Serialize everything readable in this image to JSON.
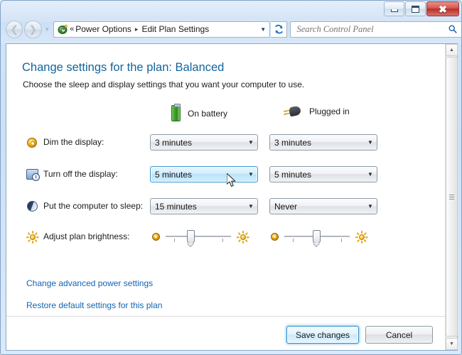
{
  "window": {
    "controls": {
      "minimize": "Minimize",
      "maximize": "Maximize",
      "close": "Close"
    }
  },
  "nav": {
    "back_label": "Back",
    "forward_label": "Forward",
    "recent_label": "Recent pages",
    "address_icon": "power-options-icon",
    "chevrons": "«",
    "breadcrumb": [
      {
        "label": "Power Options"
      },
      {
        "label": "Edit Plan Settings"
      }
    ],
    "breadcrumb_separator": "▸",
    "dropdown_glyph": "▼",
    "refresh_label": "Refresh",
    "search": {
      "placeholder": "Search Control Panel",
      "value": "",
      "icon": "search-icon"
    }
  },
  "content": {
    "heading": "Change settings for the plan: Balanced",
    "subheading": "Choose the sleep and display settings that you want your computer to use.",
    "columns": [
      {
        "id": "on-battery",
        "label": "On battery",
        "icon": "battery-icon"
      },
      {
        "id": "plugged-in",
        "label": "Plugged in",
        "icon": "power-plug-icon"
      }
    ],
    "rows": [
      {
        "id": "dim-display",
        "icon": "dim-display-icon",
        "label": "Dim the display:",
        "type": "combo",
        "on_battery": "3 minutes",
        "plugged_in": "3 minutes",
        "on_battery_hover": false,
        "plugged_in_hover": false
      },
      {
        "id": "turn-off-display",
        "icon": "monitor-clock-icon",
        "label": "Turn off the display:",
        "type": "combo",
        "on_battery": "5 minutes",
        "plugged_in": "5 minutes",
        "on_battery_hover": true,
        "plugged_in_hover": false
      },
      {
        "id": "sleep",
        "icon": "moon-icon",
        "label": "Put the computer to sleep:",
        "type": "combo",
        "on_battery": "15 minutes",
        "plugged_in": "Never",
        "on_battery_hover": false,
        "plugged_in_hover": false
      },
      {
        "id": "brightness",
        "icon": "brightness-sun-icon",
        "label": "Adjust plan brightness:",
        "type": "slider",
        "on_battery": "35",
        "plugged_in": "45",
        "low_icon": "dim-dot-icon",
        "high_icon": "bright-sun-icon"
      }
    ],
    "links": [
      {
        "id": "advanced",
        "label": "Change advanced power settings"
      },
      {
        "id": "restore",
        "label": "Restore default settings for this plan"
      }
    ],
    "buttons": [
      {
        "id": "save-changes",
        "label": "Save changes",
        "default": true
      },
      {
        "id": "cancel",
        "label": "Cancel",
        "default": false
      }
    ]
  },
  "scrollbar": {
    "up_glyph": "▲",
    "down_glyph": "▼"
  },
  "colors": {
    "heading": "#11659c",
    "link": "#1464b4",
    "accent": "#3c99d4",
    "close_button": "#b92f28"
  }
}
